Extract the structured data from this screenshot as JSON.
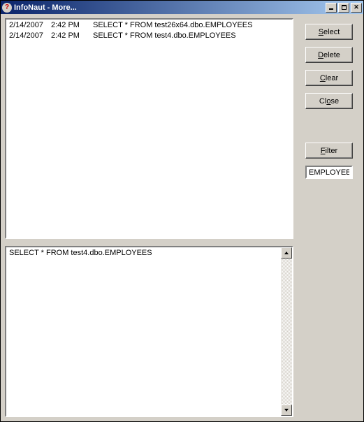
{
  "title": "InfoNaut  - More...",
  "rows": [
    {
      "date": "2/14/2007",
      "time": "2:42 PM",
      "query": "SELECT * FROM test26x64.dbo.EMPLOYEES"
    },
    {
      "date": "2/14/2007",
      "time": "2:42 PM",
      "query": "SELECT * FROM test4.dbo.EMPLOYEES"
    }
  ],
  "detail": "SELECT * FROM test4.dbo.EMPLOYEES",
  "buttons": {
    "select": "Select",
    "delete": "Delete",
    "clear": "Clear",
    "close": "Close",
    "filter": "Filter"
  },
  "filter_value": "EMPLOYEE"
}
